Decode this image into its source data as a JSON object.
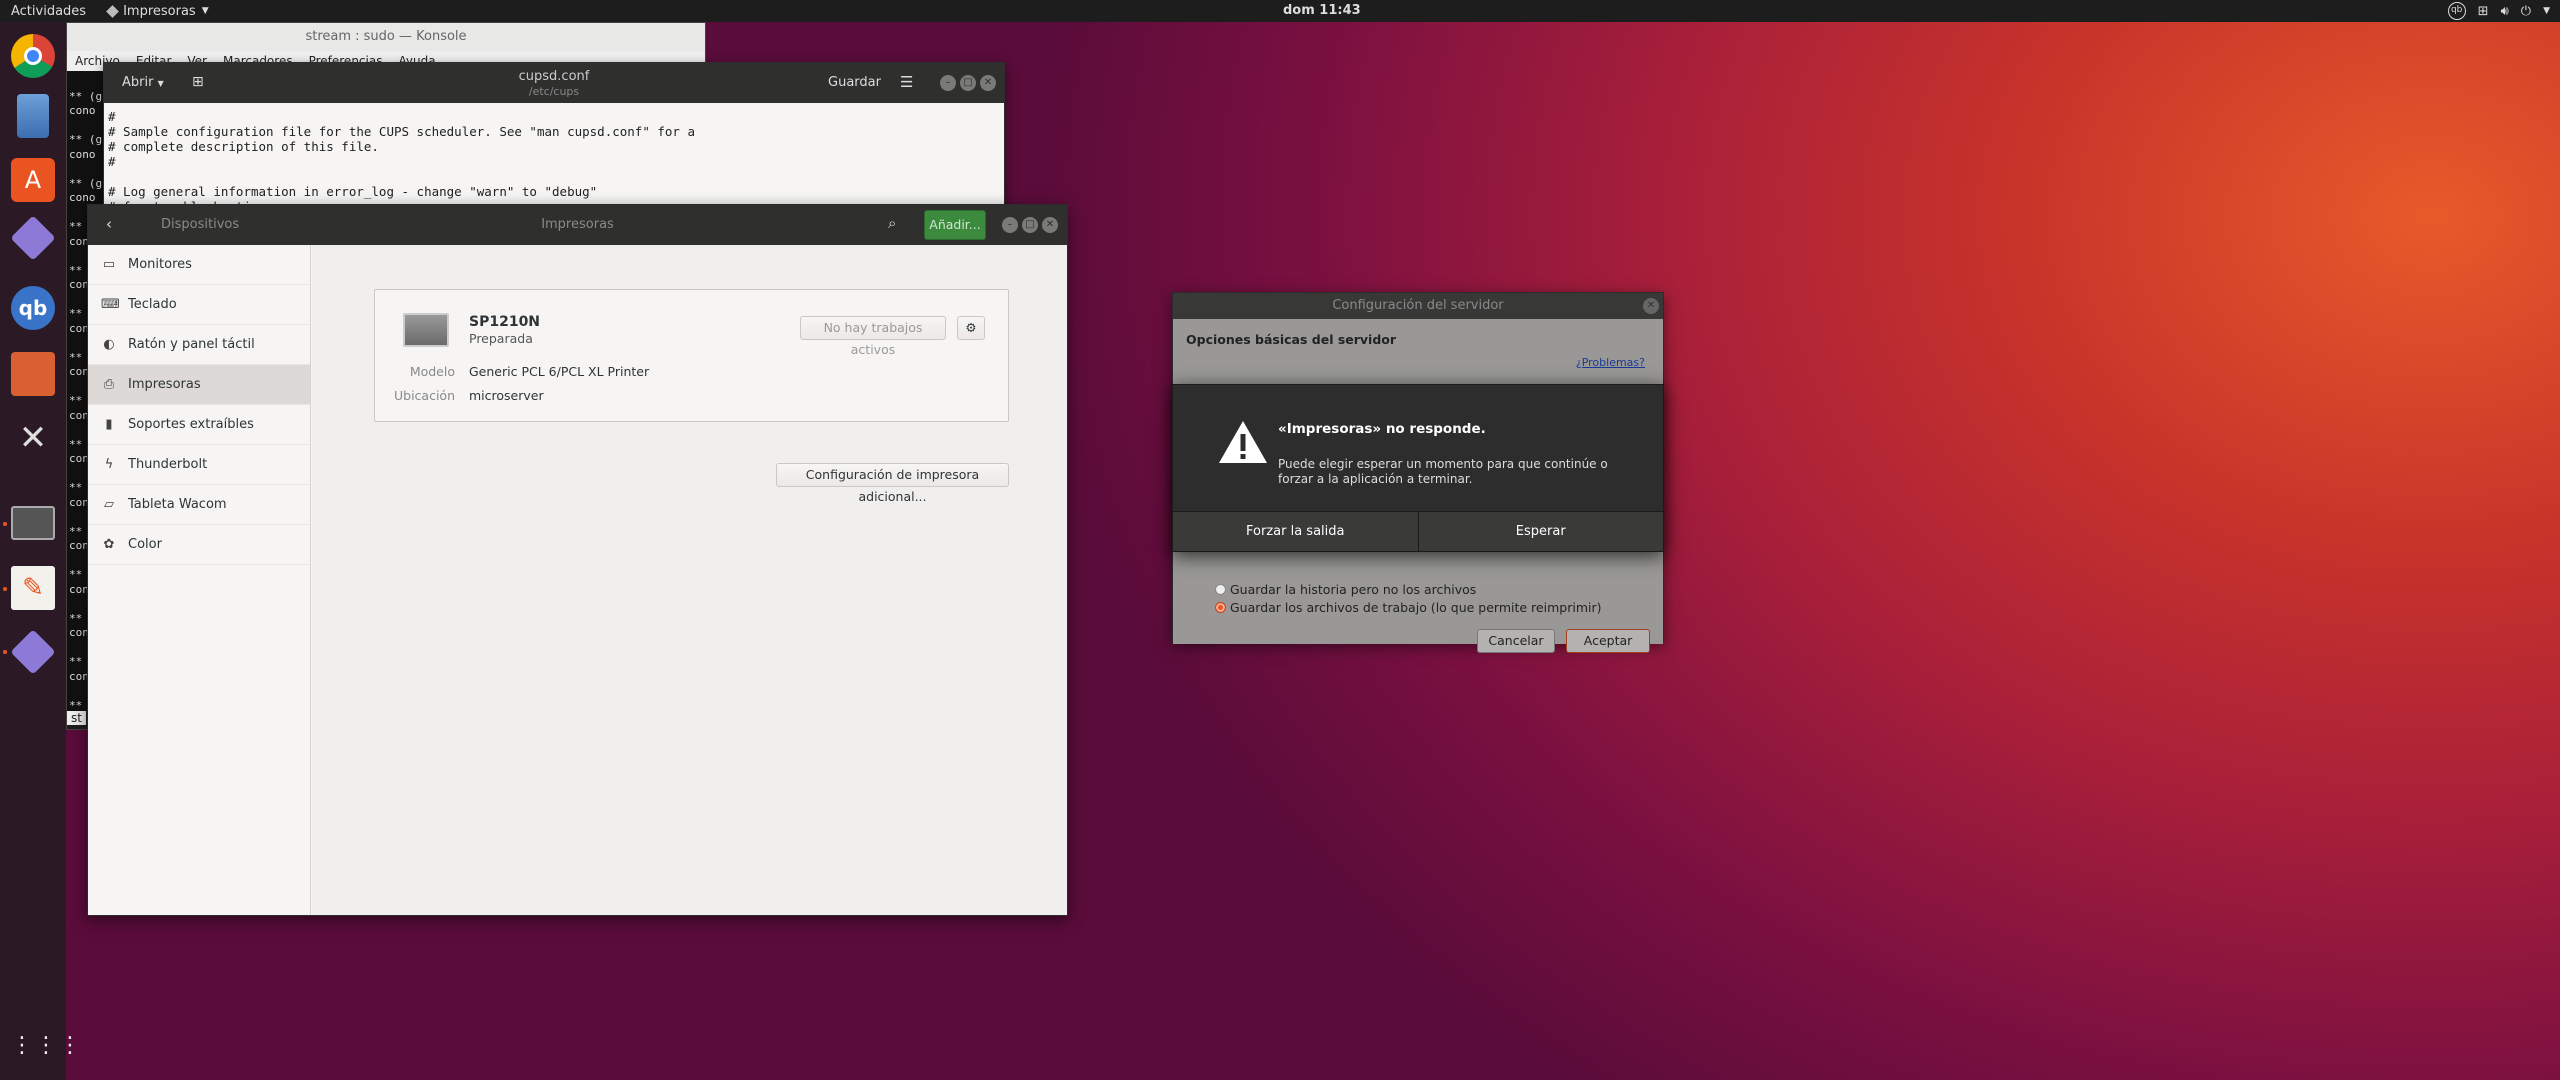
{
  "topbar": {
    "activities": "Actividades",
    "app_menu": "Impresoras",
    "clock": "dom 11:43"
  },
  "konsole": {
    "title": "stream : sudo — Konsole",
    "menu": [
      "Archivo",
      "Editar",
      "Ver",
      "Marcadores",
      "Preferencias",
      "Ayuda"
    ],
    "lines": [
      "",
      "** (g",
      "cono",
      "",
      "** (g",
      "cono",
      "",
      "** (g",
      "cono",
      "",
      "**",
      "cono",
      "",
      "**",
      "cono",
      "",
      "**",
      "cono",
      "",
      "**",
      "cono",
      "",
      "**",
      "cono",
      "",
      "**",
      "cono",
      "",
      "**",
      "cono",
      "",
      "**",
      "cono",
      "",
      "**",
      "cono",
      "",
      "**",
      "cono",
      "",
      "**",
      "cono",
      "",
      "**",
      "cono"
    ],
    "tab": "st"
  },
  "gedit": {
    "open_label": "Abrir",
    "title": "cupsd.conf",
    "subtitle": "/etc/cups",
    "save_label": "Guardar",
    "text": "#\n# Sample configuration file for the CUPS scheduler. See \"man cupsd.conf\" for a\n# complete description of this file.\n#\n\n# Log general information in error_log - change \"warn\" to \"debug\"\n# for troubleshooting..."
  },
  "settings": {
    "back_section": "Dispositivos",
    "title": "Impresoras",
    "add_button": "Añadir...",
    "sidebar": [
      {
        "label": "Monitores",
        "icon": "monitor-icon"
      },
      {
        "label": "Teclado",
        "icon": "keyboard-icon"
      },
      {
        "label": "Ratón y panel táctil",
        "icon": "mouse-icon"
      },
      {
        "label": "Impresoras",
        "icon": "printer-icon",
        "selected": true
      },
      {
        "label": "Soportes extraíbles",
        "icon": "usb-icon"
      },
      {
        "label": "Thunderbolt",
        "icon": "thunderbolt-icon"
      },
      {
        "label": "Tableta Wacom",
        "icon": "tablet-icon"
      },
      {
        "label": "Color",
        "icon": "color-icon"
      }
    ],
    "printer": {
      "name": "SP1210N",
      "status": "Preparada",
      "jobs_button": "No hay trabajos activos",
      "model_label": "Modelo",
      "model_value": "Generic PCL 6/PCL XL Printer",
      "location_label": "Ubicación",
      "location_value": "microserver"
    },
    "extra_config_button": "Configuración de impresora adicional..."
  },
  "server_config": {
    "title": "Configuración del servidor",
    "heading": "Opciones básicas del servidor",
    "problems_link": "¿Problemas?",
    "radio1": "Guardar la historia pero no los archivos",
    "radio2": "Guardar los archivos de trabajo (lo que permite reimprimir)",
    "cancel": "Cancelar",
    "accept": "Aceptar"
  },
  "alert": {
    "title": "«Impresoras» no responde.",
    "message": "Puede elegir esperar un momento para que continúe o forzar a la aplicación a terminar.",
    "force_quit": "Forzar la salida",
    "wait": "Esperar"
  },
  "colors": {
    "accent": "#e95420",
    "add_button_bg": "#3b8a3d",
    "header_bg": "#2f2f2e"
  }
}
